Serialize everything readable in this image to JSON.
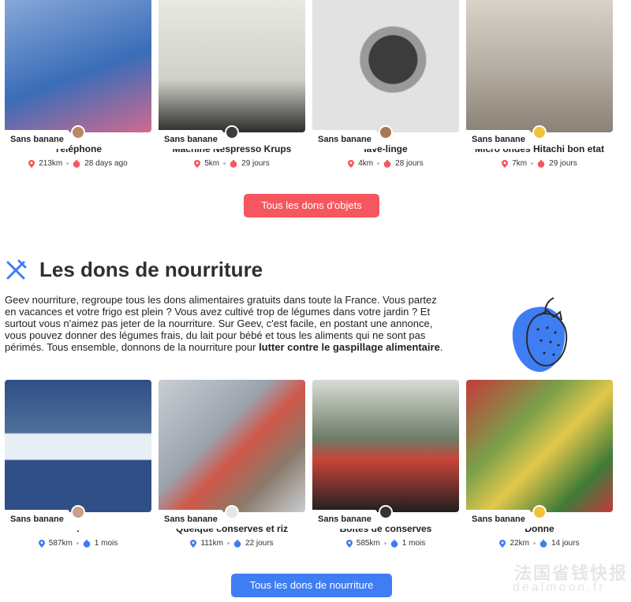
{
  "objects": {
    "badge": "Sans banane",
    "items": [
      {
        "title": "Téléphone",
        "distance": "213km",
        "age": "28 days ago",
        "img_color": "#3a6db8",
        "avatar_color": "#b88a64"
      },
      {
        "title": "Machine Nespresso Krups",
        "distance": "5km",
        "age": "29 jours",
        "img_color": "#cfd2c7",
        "avatar_color": "#3b3b3b"
      },
      {
        "title": "lave-linge",
        "distance": "4km",
        "age": "28 jours",
        "img_color": "#d9d9d9",
        "avatar_color": "#a87a54"
      },
      {
        "title": "Micro ondes Hitachi bon etat",
        "distance": "7km",
        "age": "29 jours",
        "img_color": "#b3aba0",
        "avatar_color": "#f3c23b"
      }
    ],
    "button_label": "Tous les dons d'objets"
  },
  "food": {
    "section_title": "Les dons de nourriture",
    "description_text": "Geev nourriture, regroupe tous les dons alimentaires gratuits dans toute la France. Vous partez en vacances et votre frigo est plein ? Vous avez cultivé trop de légumes dans votre jardin ? Et surtout vous n'aimez pas jeter de la nourriture. Sur Geev, c'est facile, en postant une annonce, vous pouvez donner des légumes frais, du lait pour bébé et tous les aliments qui ne sont pas périmés. Tous ensemble, donnons de la nourriture pour ",
    "description_bold": "lutter contre le gaspillage alimentaire",
    "description_end": ".",
    "badge": "Sans banane",
    "items": [
      {
        "title": ".",
        "distance": "587km",
        "age": "1 mois",
        "img_color": "#4f6f9a",
        "avatar_color": "#c7a088"
      },
      {
        "title": "Quelque conserves et riz",
        "distance": "111km",
        "age": "22 jours",
        "img_color": "#9aa3ad",
        "avatar_color": "#e6e6e6"
      },
      {
        "title": "Boîtes de conserves",
        "distance": "585km",
        "age": "1 mois",
        "img_color": "#6d7b66",
        "avatar_color": "#333333"
      },
      {
        "title": "Donne",
        "distance": "22km",
        "age": "14 jours",
        "img_color": "#7aa04b",
        "avatar_color": "#f3c23b"
      }
    ],
    "button_label": "Tous les dons de nourriture"
  },
  "watermark": {
    "line1": "法国省钱快报",
    "line2": "dealmoon.fr"
  },
  "colors": {
    "objects_accent": "#f6565d",
    "food_accent": "#3f7df3",
    "pin_red": "#f6565d",
    "pin_blue": "#3f7df3"
  }
}
